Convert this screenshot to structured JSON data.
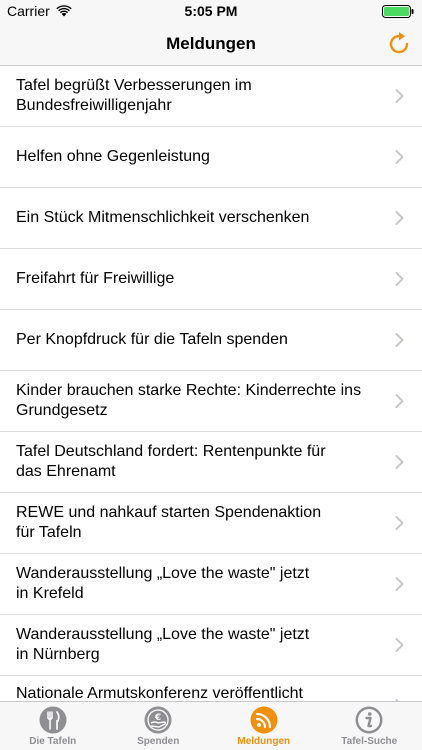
{
  "status_bar": {
    "carrier": "Carrier",
    "time": "5:05 PM"
  },
  "nav": {
    "title": "Meldungen"
  },
  "news": {
    "items": [
      {
        "title": "Tafel begrüßt Verbesserungen im\nBundesfreiwilligenjahr"
      },
      {
        "title": "Helfen ohne Gegenleistung"
      },
      {
        "title": "Ein Stück Mitmenschlichkeit verschenken"
      },
      {
        "title": "Freifahrt für Freiwillige"
      },
      {
        "title": "Per Knopfdruck für die Tafeln spenden"
      },
      {
        "title": "Kinder brauchen starke Rechte: Kinderrechte ins\nGrundgesetz"
      },
      {
        "title": "Tafel Deutschland fordert: Rentenpunkte für\ndas Ehrenamt"
      },
      {
        "title": "REWE und nahkauf starten Spendenaktion\nfür Tafeln"
      },
      {
        "title": "Wanderausstellung „Love the waste\" jetzt\nin Krefeld"
      },
      {
        "title": "Wanderausstellung „Love the waste\" jetzt\nin Nürnberg"
      },
      {
        "title": "Nationale Armutskonferenz veröffentlicht"
      }
    ]
  },
  "tabs": [
    {
      "label": "Die Tafeln",
      "icon": "cutlery-icon",
      "active": false
    },
    {
      "label": "Spenden",
      "icon": "donate-hand-icon",
      "active": false
    },
    {
      "label": "Meldungen",
      "icon": "rss-feed-icon",
      "active": true
    },
    {
      "label": "Tafel-Suche",
      "icon": "info-icon",
      "active": false
    }
  ],
  "colors": {
    "accent": "#f0900f",
    "inactive": "#8e8e93",
    "bar_background": "#f7f7f7",
    "separator": "#dcdce0"
  }
}
